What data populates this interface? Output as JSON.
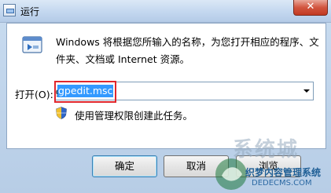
{
  "window": {
    "title": "运行",
    "close_label": "✕"
  },
  "dialog": {
    "description": "Windows 将根据您所输入的名称，为您打开相应的程序、文件夹、文档或 Internet 资源。",
    "open_label": "打开(O):",
    "input_value": "gpedit.msc",
    "admin_note": "使用管理权限创建此任务。"
  },
  "buttons": {
    "ok": "确定",
    "cancel": "取消",
    "browse": "浏览"
  },
  "watermark": {
    "title": "系统城",
    "line1": "织梦内容管理系统",
    "line2": "DEDECMS.COM"
  },
  "colors": {
    "selection": "#3399ff",
    "highlight_box": "#e0262c",
    "close_button": "#c23a22"
  }
}
